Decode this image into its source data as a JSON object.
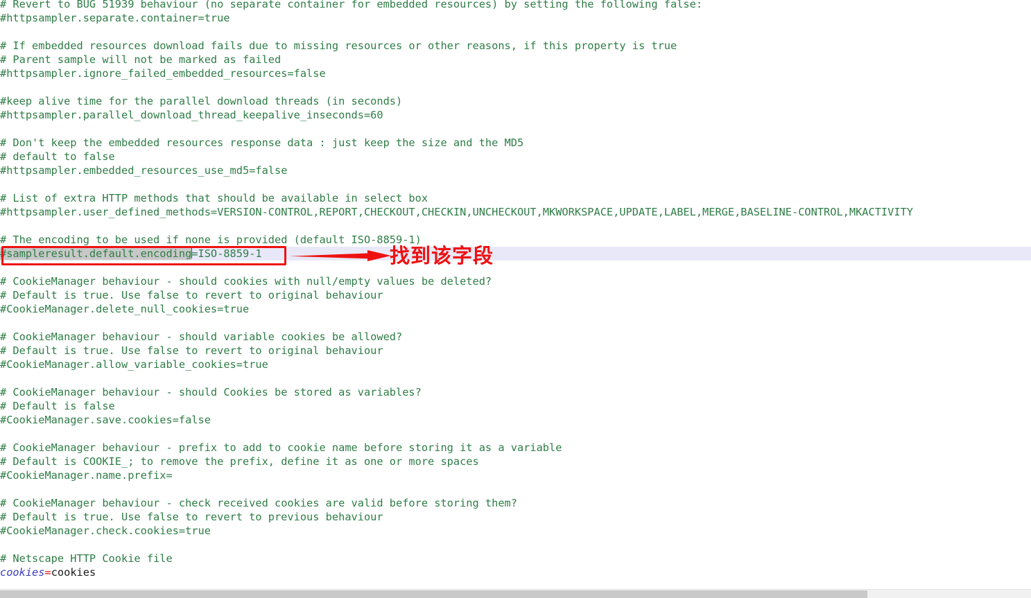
{
  "document": {
    "kind": "properties-file",
    "syntax_colors": {
      "comment": "#2e7d46",
      "property_key": "#3b3bc8",
      "equals": "#d01010",
      "property_value": "#1a1a1a",
      "selection": "#c8c8c8",
      "active_line": "#e8e8f8",
      "caret": "#3a3ad0"
    },
    "lines": [
      "# Revert to BUG 51939 behaviour (no separate container for embedded resources) by setting the following false:",
      "#httpsampler.separate.container=true",
      "",
      "# If embedded resources download fails due to missing resources or other reasons, if this property is true",
      "# Parent sample will not be marked as failed",
      "#httpsampler.ignore_failed_embedded_resources=false",
      "",
      "#keep alive time for the parallel download threads (in seconds)",
      "#httpsampler.parallel_download_thread_keepalive_inseconds=60",
      "",
      "# Don't keep the embedded resources response data : just keep the size and the MD5",
      "# default to false",
      "#httpsampler.embedded_resources_use_md5=false",
      "",
      "# List of extra HTTP methods that should be available in select box",
      "#httpsampler.user_defined_methods=VERSION-CONTROL,REPORT,CHECKOUT,CHECKIN,UNCHECKOUT,MKWORKSPACE,UPDATE,LABEL,MERGE,BASELINE-CONTROL,MKACTIVITY",
      "",
      "# The encoding to be used if none is provided (default ISO-8859-1)",
      "__ACTIVE__",
      "",
      "# CookieManager behaviour - should cookies with null/empty values be deleted?",
      "# Default is true. Use false to revert to original behaviour",
      "#CookieManager.delete_null_cookies=true",
      "",
      "# CookieManager behaviour - should variable cookies be allowed?",
      "# Default is true. Use false to revert to original behaviour",
      "#CookieManager.allow_variable_cookies=true",
      "",
      "# CookieManager behaviour - should Cookies be stored as variables?",
      "# Default is false",
      "#CookieManager.save.cookies=false",
      "",
      "# CookieManager behaviour - prefix to add to cookie name before storing it as a variable",
      "# Default is COOKIE_; to remove the prefix, define it as one or more spaces",
      "#CookieManager.name.prefix=",
      "",
      "# CookieManager behaviour - check received cookies are valid before storing them?",
      "# Default is true. Use false to revert to previous behaviour",
      "#CookieManager.check.cookies=true",
      "",
      "# Netscape HTTP Cookie file",
      "__LASTPROP__"
    ],
    "active_line": {
      "selected_text": "#sampleresult.default.encoding",
      "after_caret": "=ISO-8859-1"
    },
    "last_property": {
      "key": "cookies",
      "equals": "=",
      "value": "cookies"
    }
  },
  "annotation": {
    "label": "找到该字段",
    "color": "#ee1111",
    "arrow": "right-arrow-icon",
    "box": "highlight-rectangle"
  },
  "scrollbar": {
    "orientation": "horizontal",
    "thumb_label": "horizontal-scroll-thumb"
  }
}
